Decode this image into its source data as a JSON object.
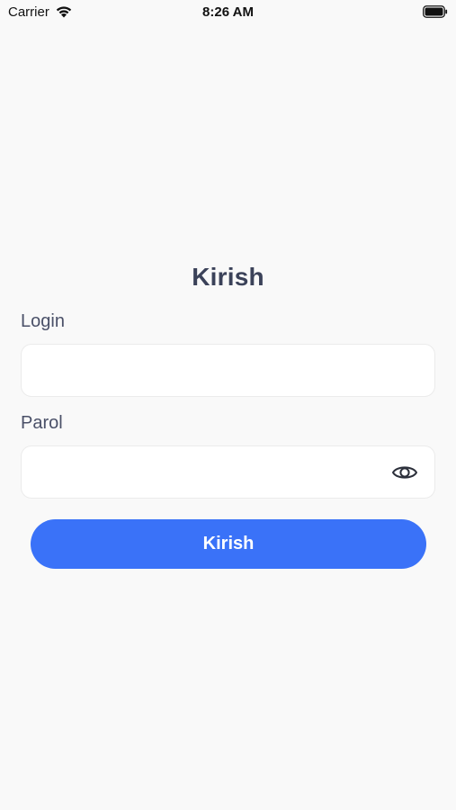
{
  "status_bar": {
    "carrier": "Carrier",
    "time": "8:26 AM",
    "wifi_icon": "wifi-icon",
    "battery_icon": "battery-icon"
  },
  "form": {
    "title": "Kirish",
    "login_label": "Login",
    "login_value": "",
    "login_placeholder": "",
    "password_label": "Parol",
    "password_value": "",
    "password_placeholder": "",
    "password_toggle_icon": "eye-icon",
    "submit_label": "Kirish"
  },
  "colors": {
    "background": "#f9f9f9",
    "accent": "#3a72f8",
    "title": "#3b4259",
    "label": "#4a5068"
  }
}
